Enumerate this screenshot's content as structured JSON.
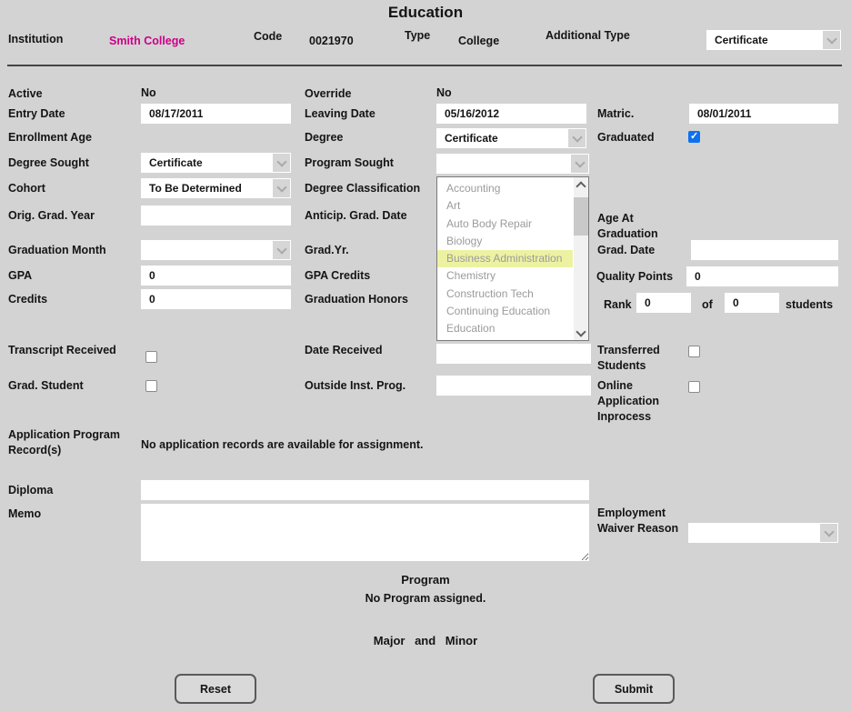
{
  "page": {
    "title": "Education"
  },
  "colors": {
    "background": "#d3d3d3",
    "institution_link": "#cc0087",
    "checkbox_checked": "#0e72ed",
    "dropdown_highlight": "#edf2a2"
  },
  "header": {
    "institution_label": "Institution",
    "institution_value": "Smith College",
    "code_label": "Code",
    "code_value": "0021970",
    "type_label": "Type",
    "type_value": "College",
    "additional_type_label": "Additional Type",
    "additional_type_value": "Certificate"
  },
  "fields": {
    "active_label": "Active",
    "active_value": "No",
    "override_label": "Override",
    "override_value": "No",
    "entry_date_label": "Entry Date",
    "entry_date_value": "08/17/2011",
    "leaving_date_label": "Leaving Date",
    "leaving_date_value": "05/16/2012",
    "matric_label": "Matric.",
    "matric_value": "08/01/2011",
    "enrollment_age_label": "Enrollment Age",
    "degree_label": "Degree",
    "degree_value": "Certificate",
    "graduated_label": "Graduated",
    "degree_sought_label": "Degree Sought",
    "degree_sought_value": "Certificate",
    "program_sought_label": "Program Sought",
    "program_sought_value": "",
    "cohort_label": "Cohort",
    "cohort_value": "To Be Determined",
    "degree_classification_label": "Degree Classification",
    "orig_grad_year_label": "Orig. Grad. Year",
    "orig_grad_year_value": "",
    "anticip_grad_date_label": "Anticip. Grad. Date",
    "age_at_graduation_label": "Age At Graduation",
    "graduation_month_label": "Graduation Month",
    "graduation_month_value": "",
    "grad_yr_label": "Grad.Yr.",
    "grad_date_label": "Grad. Date",
    "grad_date_value": "",
    "gpa_label": "GPA",
    "gpa_value": "0",
    "gpa_credits_label": "GPA Credits",
    "quality_points_label": "Quality Points",
    "quality_points_value": "0",
    "credits_label": "Credits",
    "credits_value": "0",
    "graduation_honors_label": "Graduation Honors",
    "rank_label": "Rank",
    "rank_value": "0",
    "of_label": "of",
    "rank_total_value": "0",
    "students_label": "students",
    "transcript_received_label": "Transcript Received",
    "date_received_label": "Date Received",
    "date_received_value": "",
    "transferred_students_label": "Transferred Students",
    "grad_student_label": "Grad. Student",
    "outside_inst_prog_label": "Outside Inst. Prog.",
    "outside_inst_prog_value": "",
    "online_application_label": "Online Application Inprocess",
    "application_program_label": "Application Program Record(s)",
    "application_program_message": "No application records are available for assignment.",
    "diploma_label": "Diploma",
    "diploma_value": "",
    "memo_label": "Memo",
    "memo_value": "",
    "employment_waiver_label": "Employment Waiver Reason",
    "employment_waiver_value": ""
  },
  "checkboxes": {
    "graduated": true,
    "transcript_received": false,
    "transferred_students": false,
    "grad_student": false,
    "online_application": false
  },
  "program_sought_dropdown": {
    "options": [
      "Accounting",
      "Art",
      "Auto Body Repair",
      "Biology",
      "Business Administration",
      "Chemistry",
      "Construction Tech",
      "Continuing Education",
      "Education"
    ],
    "highlighted": "Business Administration"
  },
  "sections": {
    "program_title": "Program",
    "program_message": "No Program assigned.",
    "major_minor_title": "Major and Minor"
  },
  "buttons": {
    "reset": "Reset",
    "submit": "Submit"
  }
}
